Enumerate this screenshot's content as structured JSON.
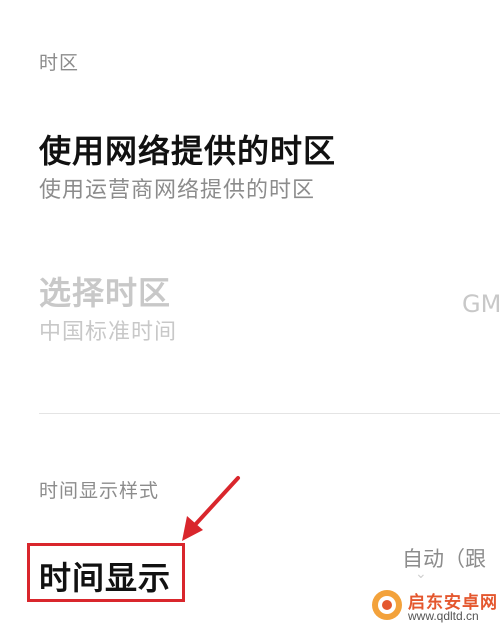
{
  "timezone_section": {
    "header": "时区",
    "auto_timezone": {
      "title": "使用网络提供的时区",
      "subtitle": "使用运营商网络提供的时区"
    },
    "select_timezone": {
      "title": "选择时区",
      "subtitle": "中国标准时间",
      "value": "GM"
    }
  },
  "time_format_section": {
    "header": "时间显示样式",
    "time_display": {
      "title": "时间显示",
      "value": "自动（跟"
    }
  },
  "watermark": {
    "name": "启东安卓网",
    "url": "www.qdltd.cn"
  },
  "colors": {
    "annotation_red": "#d9262c",
    "disabled_text": "#c8c8c8",
    "secondary_text": "#8c8c8c",
    "primary_text": "#111111",
    "watermark_orange": "#e4572e"
  }
}
